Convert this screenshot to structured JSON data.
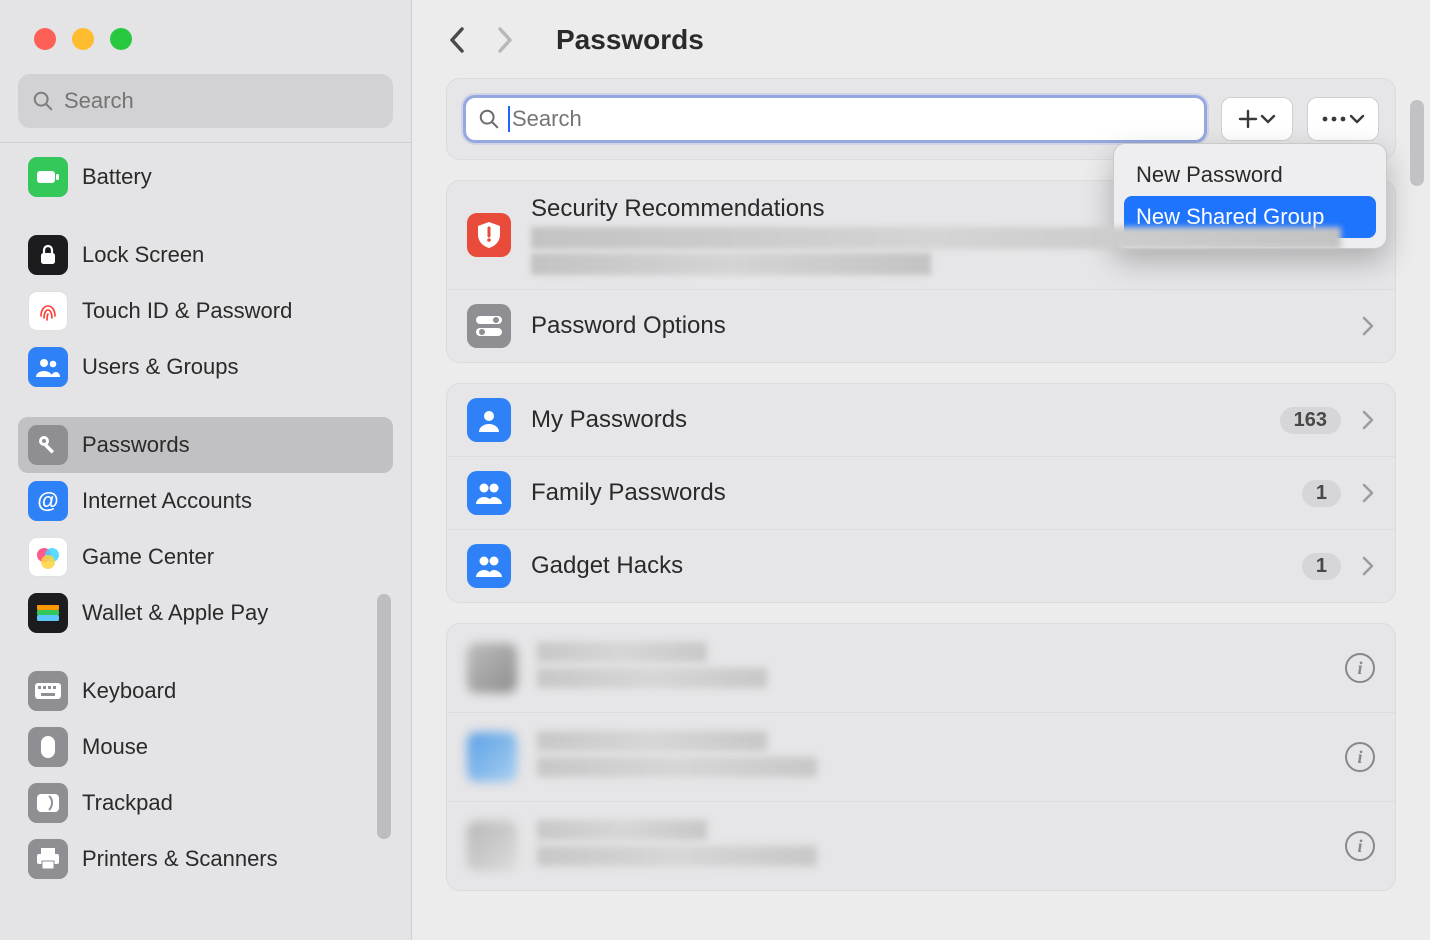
{
  "sidebar": {
    "search_placeholder": "Search",
    "items": [
      {
        "label": "Battery"
      },
      {
        "label": "Lock Screen"
      },
      {
        "label": "Touch ID & Password"
      },
      {
        "label": "Users & Groups"
      },
      {
        "label": "Passwords"
      },
      {
        "label": "Internet Accounts"
      },
      {
        "label": "Game Center"
      },
      {
        "label": "Wallet & Apple Pay"
      },
      {
        "label": "Keyboard"
      },
      {
        "label": "Mouse"
      },
      {
        "label": "Trackpad"
      },
      {
        "label": "Printers & Scanners"
      }
    ]
  },
  "header": {
    "title": "Passwords"
  },
  "toolbar": {
    "search_placeholder": "Search",
    "dropdown": {
      "item1": "New Password",
      "item2": "New Shared Group"
    }
  },
  "sec": {
    "recs": "Security Recommendations",
    "options": "Password Options"
  },
  "groups": [
    {
      "label": "My Passwords",
      "count": "163"
    },
    {
      "label": "Family Passwords",
      "count": "1"
    },
    {
      "label": "Gadget Hacks",
      "count": "1"
    }
  ],
  "colors": {
    "accent": "#1e74fd",
    "blue_tile": "#2f81f7",
    "red_tile": "#e84b3a",
    "grey_tile": "#8e8e93",
    "green_tile": "#34c759"
  }
}
